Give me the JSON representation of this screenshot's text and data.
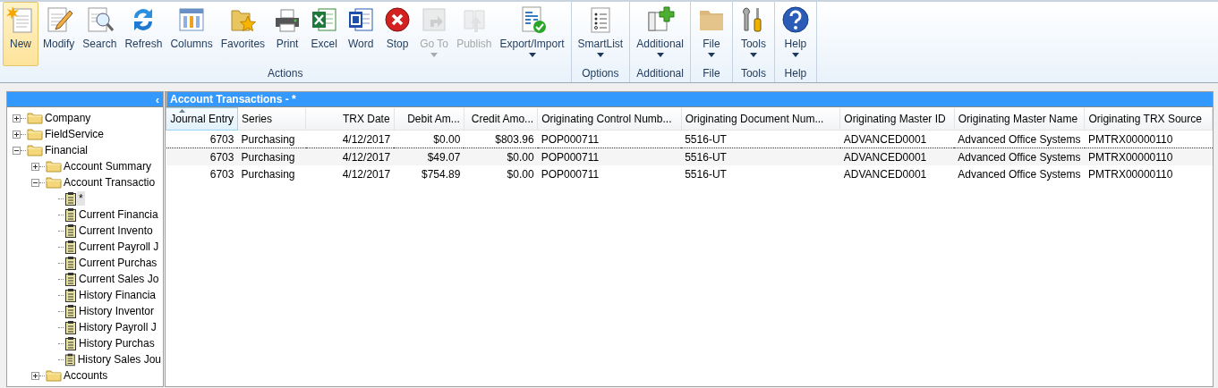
{
  "ribbon": {
    "groups": [
      {
        "caption": "Actions",
        "buttons": [
          {
            "label": "New",
            "selected": true,
            "disabled": false,
            "dropdown": false
          },
          {
            "label": "Modify",
            "selected": false,
            "disabled": false,
            "dropdown": false
          },
          {
            "label": "Search",
            "selected": false,
            "disabled": false,
            "dropdown": false
          },
          {
            "label": "Refresh",
            "selected": false,
            "disabled": false,
            "dropdown": false
          },
          {
            "label": "Columns",
            "selected": false,
            "disabled": false,
            "dropdown": false
          },
          {
            "label": "Favorites",
            "selected": false,
            "disabled": false,
            "dropdown": false
          },
          {
            "label": "Print",
            "selected": false,
            "disabled": false,
            "dropdown": false
          },
          {
            "label": "Excel",
            "selected": false,
            "disabled": false,
            "dropdown": false
          },
          {
            "label": "Word",
            "selected": false,
            "disabled": false,
            "dropdown": false
          },
          {
            "label": "Stop",
            "selected": false,
            "disabled": false,
            "dropdown": false
          },
          {
            "label": "Go To",
            "selected": false,
            "disabled": true,
            "dropdown": true
          },
          {
            "label": "Publish",
            "selected": false,
            "disabled": true,
            "dropdown": false
          },
          {
            "label": "Export/Import",
            "selected": false,
            "disabled": false,
            "dropdown": true
          }
        ]
      },
      {
        "caption": "Options",
        "buttons": [
          {
            "label": "SmartList",
            "selected": false,
            "disabled": false,
            "dropdown": true
          }
        ]
      },
      {
        "caption": "Additional",
        "buttons": [
          {
            "label": "Additional",
            "selected": false,
            "disabled": false,
            "dropdown": true
          }
        ]
      },
      {
        "caption": "File",
        "buttons": [
          {
            "label": "File",
            "selected": false,
            "disabled": false,
            "dropdown": true
          }
        ]
      },
      {
        "caption": "Tools",
        "buttons": [
          {
            "label": "Tools",
            "selected": false,
            "disabled": false,
            "dropdown": true
          }
        ]
      },
      {
        "caption": "Help",
        "buttons": [
          {
            "label": "Help",
            "selected": false,
            "disabled": false,
            "dropdown": true
          }
        ]
      }
    ]
  },
  "sidebar": {
    "collapse_button": "‹",
    "tree": [
      {
        "kind": "folder",
        "label": "Company",
        "expanded": false
      },
      {
        "kind": "folder",
        "label": "FieldService",
        "expanded": false
      },
      {
        "kind": "folder",
        "label": "Financial",
        "expanded": true,
        "children": [
          {
            "kind": "folder",
            "label": "Account Summary",
            "expanded": false
          },
          {
            "kind": "folder",
            "label": "Account Transactio",
            "expanded": true,
            "children": [
              {
                "kind": "list",
                "label": "*",
                "selected": true
              },
              {
                "kind": "list",
                "label": "Current Financia",
                "selected": false
              },
              {
                "kind": "list",
                "label": "Current Invento",
                "selected": false
              },
              {
                "kind": "list",
                "label": "Current Payroll J",
                "selected": false
              },
              {
                "kind": "list",
                "label": "Current Purchas",
                "selected": false
              },
              {
                "kind": "list",
                "label": "Current Sales Jo",
                "selected": false
              },
              {
                "kind": "list",
                "label": "History Financia",
                "selected": false
              },
              {
                "kind": "list",
                "label": "History Inventor",
                "selected": false
              },
              {
                "kind": "list",
                "label": "History Payroll J",
                "selected": false
              },
              {
                "kind": "list",
                "label": "History Purchas",
                "selected": false
              },
              {
                "kind": "list",
                "label": "History Sales Jou",
                "selected": false
              }
            ]
          },
          {
            "kind": "folder",
            "label": "Accounts",
            "expanded": false
          }
        ]
      }
    ]
  },
  "table": {
    "title": "Account Transactions - *",
    "columns": [
      {
        "label": "Journal Entry",
        "kind": "number",
        "sorted": true
      },
      {
        "label": "Series",
        "kind": "text",
        "sorted": false
      },
      {
        "label": "TRX Date",
        "kind": "number",
        "sorted": false
      },
      {
        "label": "Debit Am...",
        "kind": "number",
        "sorted": false
      },
      {
        "label": "Credit Amo...",
        "kind": "number",
        "sorted": false
      },
      {
        "label": "Originating Control Numb...",
        "kind": "text",
        "sorted": false
      },
      {
        "label": "Originating Document Num...",
        "kind": "text",
        "sorted": false
      },
      {
        "label": "Originating Master ID",
        "kind": "text",
        "sorted": false
      },
      {
        "label": "Originating Master Name",
        "kind": "text",
        "sorted": false
      },
      {
        "label": "Originating TRX Source",
        "kind": "text",
        "sorted": false
      }
    ],
    "rows": [
      {
        "focused": true,
        "cells": [
          "6703",
          "Purchasing",
          "4/12/2017",
          "$0.00",
          "$803.96",
          "POP000711",
          "5516-UT",
          "ADVANCED0001",
          "Advanced Office Systems",
          "PMTRX00000110"
        ]
      },
      {
        "focused": false,
        "cells": [
          "6703",
          "Purchasing",
          "4/12/2017",
          "$49.07",
          "$0.00",
          "POP000711",
          "5516-UT",
          "ADVANCED0001",
          "Advanced Office Systems",
          "PMTRX00000110"
        ]
      },
      {
        "focused": false,
        "cells": [
          "6703",
          "Purchasing",
          "4/12/2017",
          "$754.89",
          "$0.00",
          "POP000711",
          "5516-UT",
          "ADVANCED0001",
          "Advanced Office Systems",
          "PMTRX00000110"
        ]
      }
    ]
  }
}
